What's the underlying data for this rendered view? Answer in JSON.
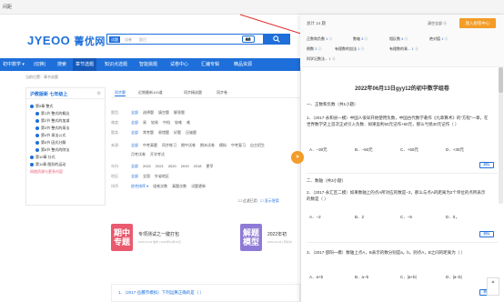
{
  "topbar": {
    "label": "间距"
  },
  "logo": {
    "brand": "JYEOO",
    "cn": "菁优网"
  },
  "search": {
    "tag_active": "试题",
    "tag_other": "试卷",
    "placeholder": "题目",
    "camera": "📷"
  },
  "nav": {
    "subject": "初中数学 ▾",
    "grade": "(切换)",
    "items": [
      "搜索",
      "章节选题",
      "知识点选题",
      "智能挑题",
      "试卷中心",
      "汇编专辑",
      "精品资源"
    ]
  },
  "breadcrumb": "当前位置：章节选题",
  "sidebar": {
    "header": "沪教版新 七年级上",
    "header_icon": "⚙",
    "items": [
      "第9章 整式",
      "第1节 整式的概念",
      "第2节 整式的加减",
      "第3节 整式的乘法",
      "第4节 乘法公式",
      "第5节 因式分解",
      "第6节 整式的除法",
      "第10章 分式",
      "第11章 图形的运动",
      "网络资源与更多内容"
    ]
  },
  "tabs": [
    "同步题",
    "近期最新100道",
    "同步精选题",
    "同步卷"
  ],
  "filters": [
    {
      "label": "题型:",
      "values": [
        "全部",
        "选择题",
        "填空题",
        "解答题"
      ]
    },
    {
      "label": "难度:",
      "values": [
        "全部",
        "易",
        "较易",
        "中档",
        "较难",
        "难"
      ]
    },
    {
      "label": "题类:",
      "values": [
        "全部",
        "常考题",
        "易错题",
        "好题",
        "压轴题"
      ]
    },
    {
      "label": "来源:",
      "values": [
        "全部",
        "中考真题",
        "同步练习",
        "期中试卷",
        "期末试卷",
        "模拟",
        "中考复习",
        "自主招生",
        "中考模拟"
      ]
    },
    {
      "label": "",
      "values": [
        "月考试卷",
        "开学考试"
      ]
    },
    {
      "label": "年份:",
      "values": [
        "全部",
        "2022",
        "2021",
        "2020",
        "2019",
        "2018",
        "更早"
      ]
    },
    {
      "label": "地区:",
      "values": [
        "全部",
        "全国",
        "外省地区"
      ]
    },
    {
      "label": "排序:",
      "values": [
        "综合排序 ▾",
        "组卷次数",
        "真题次数",
        "试题更新"
      ]
    }
  ],
  "checkboxes": [
    "☐ 过滤已用",
    "☐ 显示答案"
  ],
  "cards": [
    {
      "badge": "期中\n专题",
      "title": "专项测试之一键打包",
      "date": "2022-04-23 发布 | 2022年03月15日"
    },
    {
      "badge": "解题\n模型",
      "title": "2022年初",
      "date": "2022-04-23 | 年初中"
    }
  ],
  "question_preview": "1．（2017·岳麓市模拟）下列运算正确的是（   ）",
  "panel": {
    "total": "总计 14 题",
    "clear": "清空全部 ⓧ",
    "add_button": "放入组卷中心",
    "type_rows": [
      [
        {
          "name": "正数和负数",
          "count": "1"
        },
        {
          "name": "数轴",
          "count": "3"
        },
        {
          "name": "相反数",
          "count": "4"
        },
        {
          "name": "绝对值",
          "count": "1"
        }
      ],
      [
        {
          "name": "倒数",
          "count": "2"
        },
        {
          "name": "有理数的加法",
          "count": "1"
        },
        {
          "name": "有理数的乘...",
          "count": "1"
        }
      ],
      [
        {
          "name": "科学记数法...",
          "count": "1"
        }
      ]
    ],
    "arrow": "»",
    "paper_title": "2022年06月13日gyy12的初中数学组卷",
    "section1": "一．正数和负数（共1小题）",
    "q1_text": "1．（2017·永和县一模）中国人很早开始使用负数，中国古代数学著作《九章算术》的\"方程\"一章，在世界数学史上首次正式引入负数．如果盈利50元记作+50元，那么亏损30元记作（   ）",
    "q1_options": [
      "A．−30元",
      "B．−50元",
      "C．+50元",
      "D．+30元"
    ],
    "delete_label": "删除",
    "section2": "二．数轴（共3小题）",
    "q2_text": "2．（2017·永汇区二模）如果数轴上的点A所对应的数是−3，那么与点A的距离为2个单位的点所表示的数是（   ）",
    "q2_options": [
      "A．−2",
      "B．2",
      "C．−5",
      "D．0，"
    ],
    "q3_text": "3．（2017·邵阳一模）数轴上点A，B表示的数分别是a，b，则点A，B之间的距离为（   ）",
    "q3_options": [
      "A．a+b",
      "B．a−b",
      "C．|a+b|",
      "D．|a−b|"
    ],
    "totop": "▲"
  }
}
